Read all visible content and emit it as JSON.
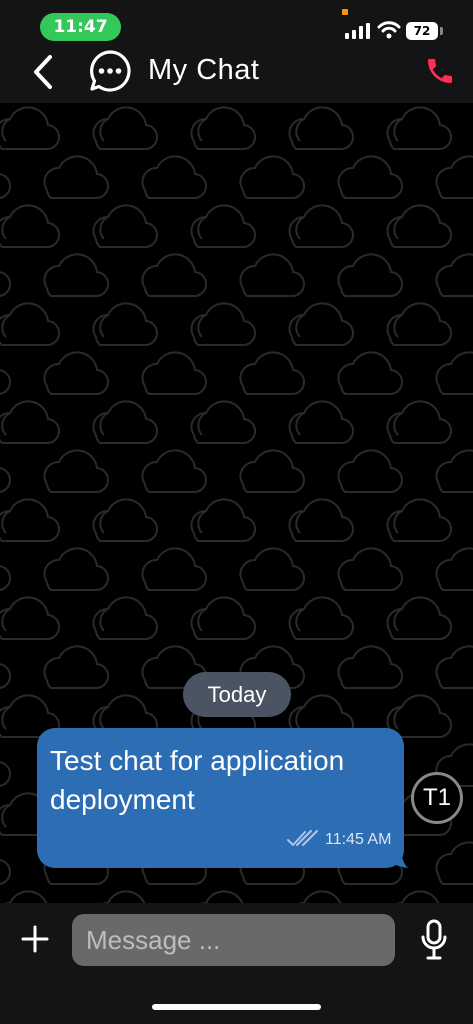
{
  "status_bar": {
    "time": "11:47",
    "battery": "72",
    "icons": [
      "signal-icon",
      "wifi-icon",
      "battery-icon"
    ]
  },
  "header": {
    "title": "My Chat",
    "back_icon": "chevron-left-icon",
    "chat_icon": "chat-bubble-dots-icon",
    "call_icon": "phone-icon"
  },
  "conversation": {
    "day_separator": "Today",
    "messages": [
      {
        "text": "Test chat for application deployment",
        "time": "11:45 AM",
        "status_icon": "double-check-icon",
        "avatar_initials": "T1"
      }
    ]
  },
  "composer": {
    "placeholder": "Message ...",
    "value": "",
    "attach_icon": "plus-icon",
    "mic_icon": "microphone-icon"
  },
  "colors": {
    "bubble": "#2c6db3",
    "day_pill": "#4a5462",
    "call_icon": "#ff2d55",
    "status_time_pill": "#34c759",
    "input_bg": "#696969"
  }
}
